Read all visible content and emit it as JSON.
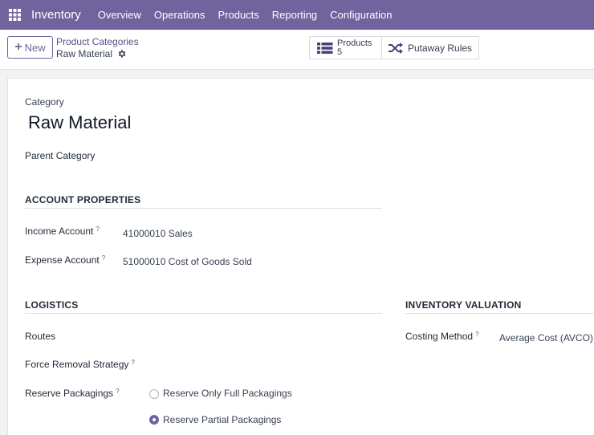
{
  "navbar": {
    "app_name": "Inventory",
    "menu": [
      "Overview",
      "Operations",
      "Products",
      "Reporting",
      "Configuration"
    ],
    "color": "#71639e"
  },
  "control": {
    "new_label": "New",
    "breadcrumb_parent": "Product Categories",
    "breadcrumb_current": "Raw Material",
    "products_label": "Products",
    "products_count": "5",
    "putaway_label": "Putaway Rules"
  },
  "form": {
    "category_label": "Category",
    "category_value": "Raw Material",
    "parent_label": "Parent Category",
    "account_section": "ACCOUNT PROPERTIES",
    "income_label": "Income Account",
    "income_value": "41000010 Sales",
    "expense_label": "Expense Account",
    "expense_value": "51000010 Cost of Goods Sold",
    "logistics_section": "LOGISTICS",
    "routes_label": "Routes",
    "removal_label": "Force Removal Strategy",
    "reserve_label": "Reserve Packagings",
    "reserve_options": [
      "Reserve Only Full Packagings",
      "Reserve Partial Packagings"
    ],
    "reserve_selected": "Reserve Partial Packagings",
    "valuation_section": "INVENTORY VALUATION",
    "costing_label": "Costing Method",
    "costing_value": "Average Cost (AVCO)",
    "help_mark": "?"
  }
}
